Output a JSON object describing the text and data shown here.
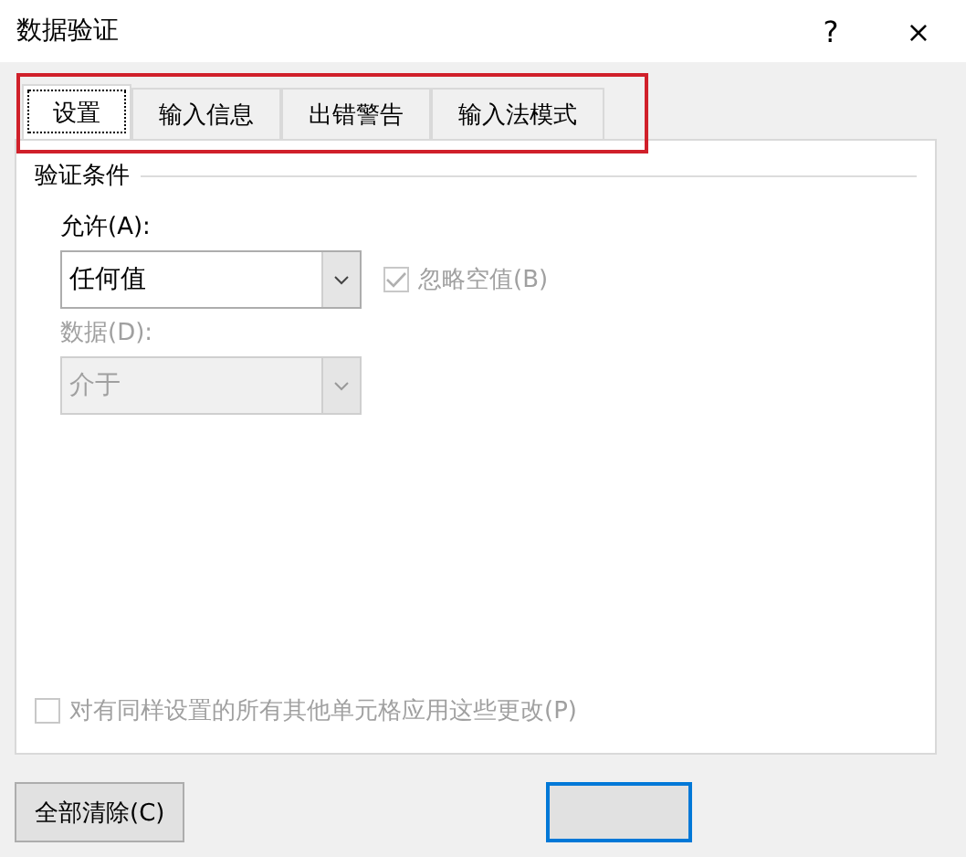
{
  "window": {
    "title": "数据验证",
    "help": "?",
    "close": "×"
  },
  "tabs": [
    {
      "label": "设置",
      "selected": true
    },
    {
      "label": "输入信息",
      "selected": false
    },
    {
      "label": "出错警告",
      "selected": false
    },
    {
      "label": "输入法模式",
      "selected": false
    }
  ],
  "tab_highlight": true,
  "group": {
    "title": "验证条件"
  },
  "allow": {
    "label": "允许(A):",
    "value": "任何值",
    "disabled": false
  },
  "ignore_blank": {
    "label": "忽略空值(B)",
    "checked": true,
    "disabled": true
  },
  "data": {
    "label": "数据(D):",
    "value": "介于",
    "disabled": true
  },
  "apply_all": {
    "label": "对有同样设置的所有其他单元格应用这些更改(P)",
    "checked": false,
    "disabled": true
  },
  "buttons": [
    {
      "kind": "clear",
      "label": "全部清除(C)"
    },
    {
      "kind": "default"
    }
  ]
}
